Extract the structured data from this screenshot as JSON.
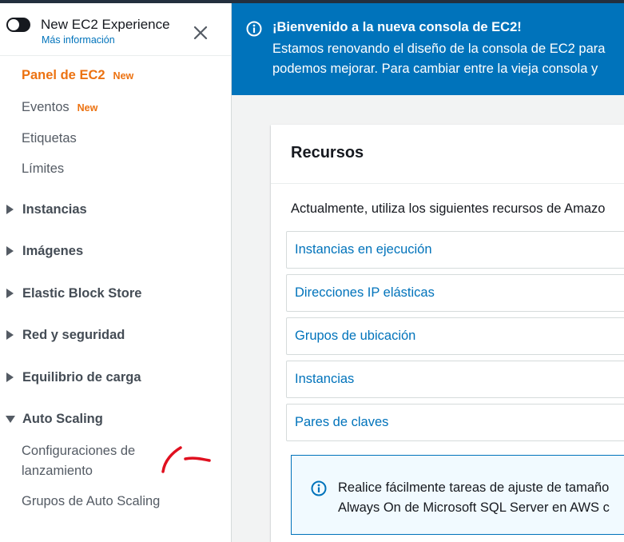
{
  "sidebar": {
    "experience_title": "New EC2 Experience",
    "experience_link": "Más información",
    "top_links": [
      {
        "label": "Panel de EC2",
        "badge": "New"
      },
      {
        "label": "Eventos",
        "badge": "New"
      },
      {
        "label": "Etiquetas"
      },
      {
        "label": "Límites"
      }
    ],
    "sections": [
      {
        "label": "Instancias",
        "expanded": false
      },
      {
        "label": "Imágenes",
        "expanded": false
      },
      {
        "label": "Elastic Block Store",
        "expanded": false
      },
      {
        "label": "Red y seguridad",
        "expanded": false
      },
      {
        "label": "Equilibrio de carga",
        "expanded": false
      },
      {
        "label": "Auto Scaling",
        "expanded": true
      }
    ],
    "auto_scaling_items": [
      {
        "label": "Configuraciones de lanzamiento"
      },
      {
        "label": "Grupos de Auto Scaling"
      }
    ]
  },
  "banner": {
    "title": "¡Bienvenido a la nueva consola de EC2!",
    "line1": "Estamos renovando el diseño de la consola de EC2 para",
    "line2": "podemos mejorar. Para cambiar entre la vieja consola y"
  },
  "resources": {
    "title": "Recursos",
    "description": "Actualmente, utiliza los siguientes recursos de Amazo",
    "items": [
      {
        "label": "Instancias en ejecución"
      },
      {
        "label": "Direcciones IP elásticas"
      },
      {
        "label": "Grupos de ubicación"
      },
      {
        "label": "Instancias"
      },
      {
        "label": "Pares de claves"
      }
    ]
  },
  "info": {
    "line1": "Realice fácilmente tareas de ajuste de tamaño",
    "line2": "Always On de Microsoft SQL Server en AWS c"
  },
  "colors": {
    "accent": "#ec7211",
    "link": "#0073bb",
    "banner": "#0073bb",
    "annotation": "#e0101f"
  }
}
